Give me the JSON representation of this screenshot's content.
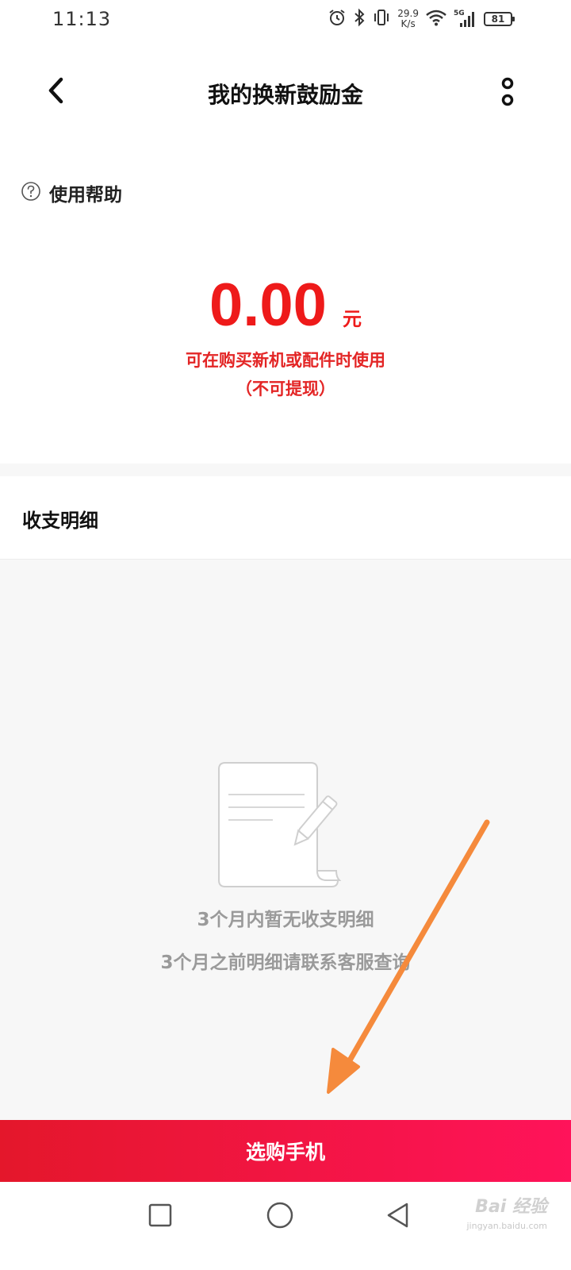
{
  "status_bar": {
    "time": "11:13",
    "net_speed_value": "29.9",
    "net_speed_unit": "K/s",
    "network_type": "5G",
    "battery_level": "81",
    "icons": [
      "alarm-icon",
      "bluetooth-icon",
      "vibrate-icon",
      "wifi-icon",
      "signal-icon",
      "battery-icon"
    ]
  },
  "header": {
    "title": "我的换新鼓励金",
    "back_icon": "back-arrow-icon",
    "more_icon": "more-vertical-icon"
  },
  "help": {
    "icon": "question-circle-icon",
    "label": "使用帮助"
  },
  "balance": {
    "amount": "0.00",
    "unit": "元",
    "note_line1": "可在购买新机或配件时使用",
    "note_line2": "（不可提现）"
  },
  "details": {
    "title": "收支明细",
    "empty_icon": "document-pen-icon",
    "empty_line1": "3个月内暂无收支明细",
    "empty_line2": "3个月之前明细请联系客服查询"
  },
  "buy_button": {
    "label": "选购手机"
  },
  "nav_bar": {
    "icons": [
      "recent-apps-icon",
      "home-icon",
      "back-icon"
    ]
  },
  "watermark": {
    "text": "Bai 经验",
    "sub": "jingyan.baidu.com"
  },
  "colors": {
    "accent_red": "#ee1a1a",
    "button_gradient_start": "#e4172b",
    "button_gradient_end": "#ff135a",
    "annotation_arrow": "#f58a3c",
    "muted_text": "#9a9a9a"
  }
}
